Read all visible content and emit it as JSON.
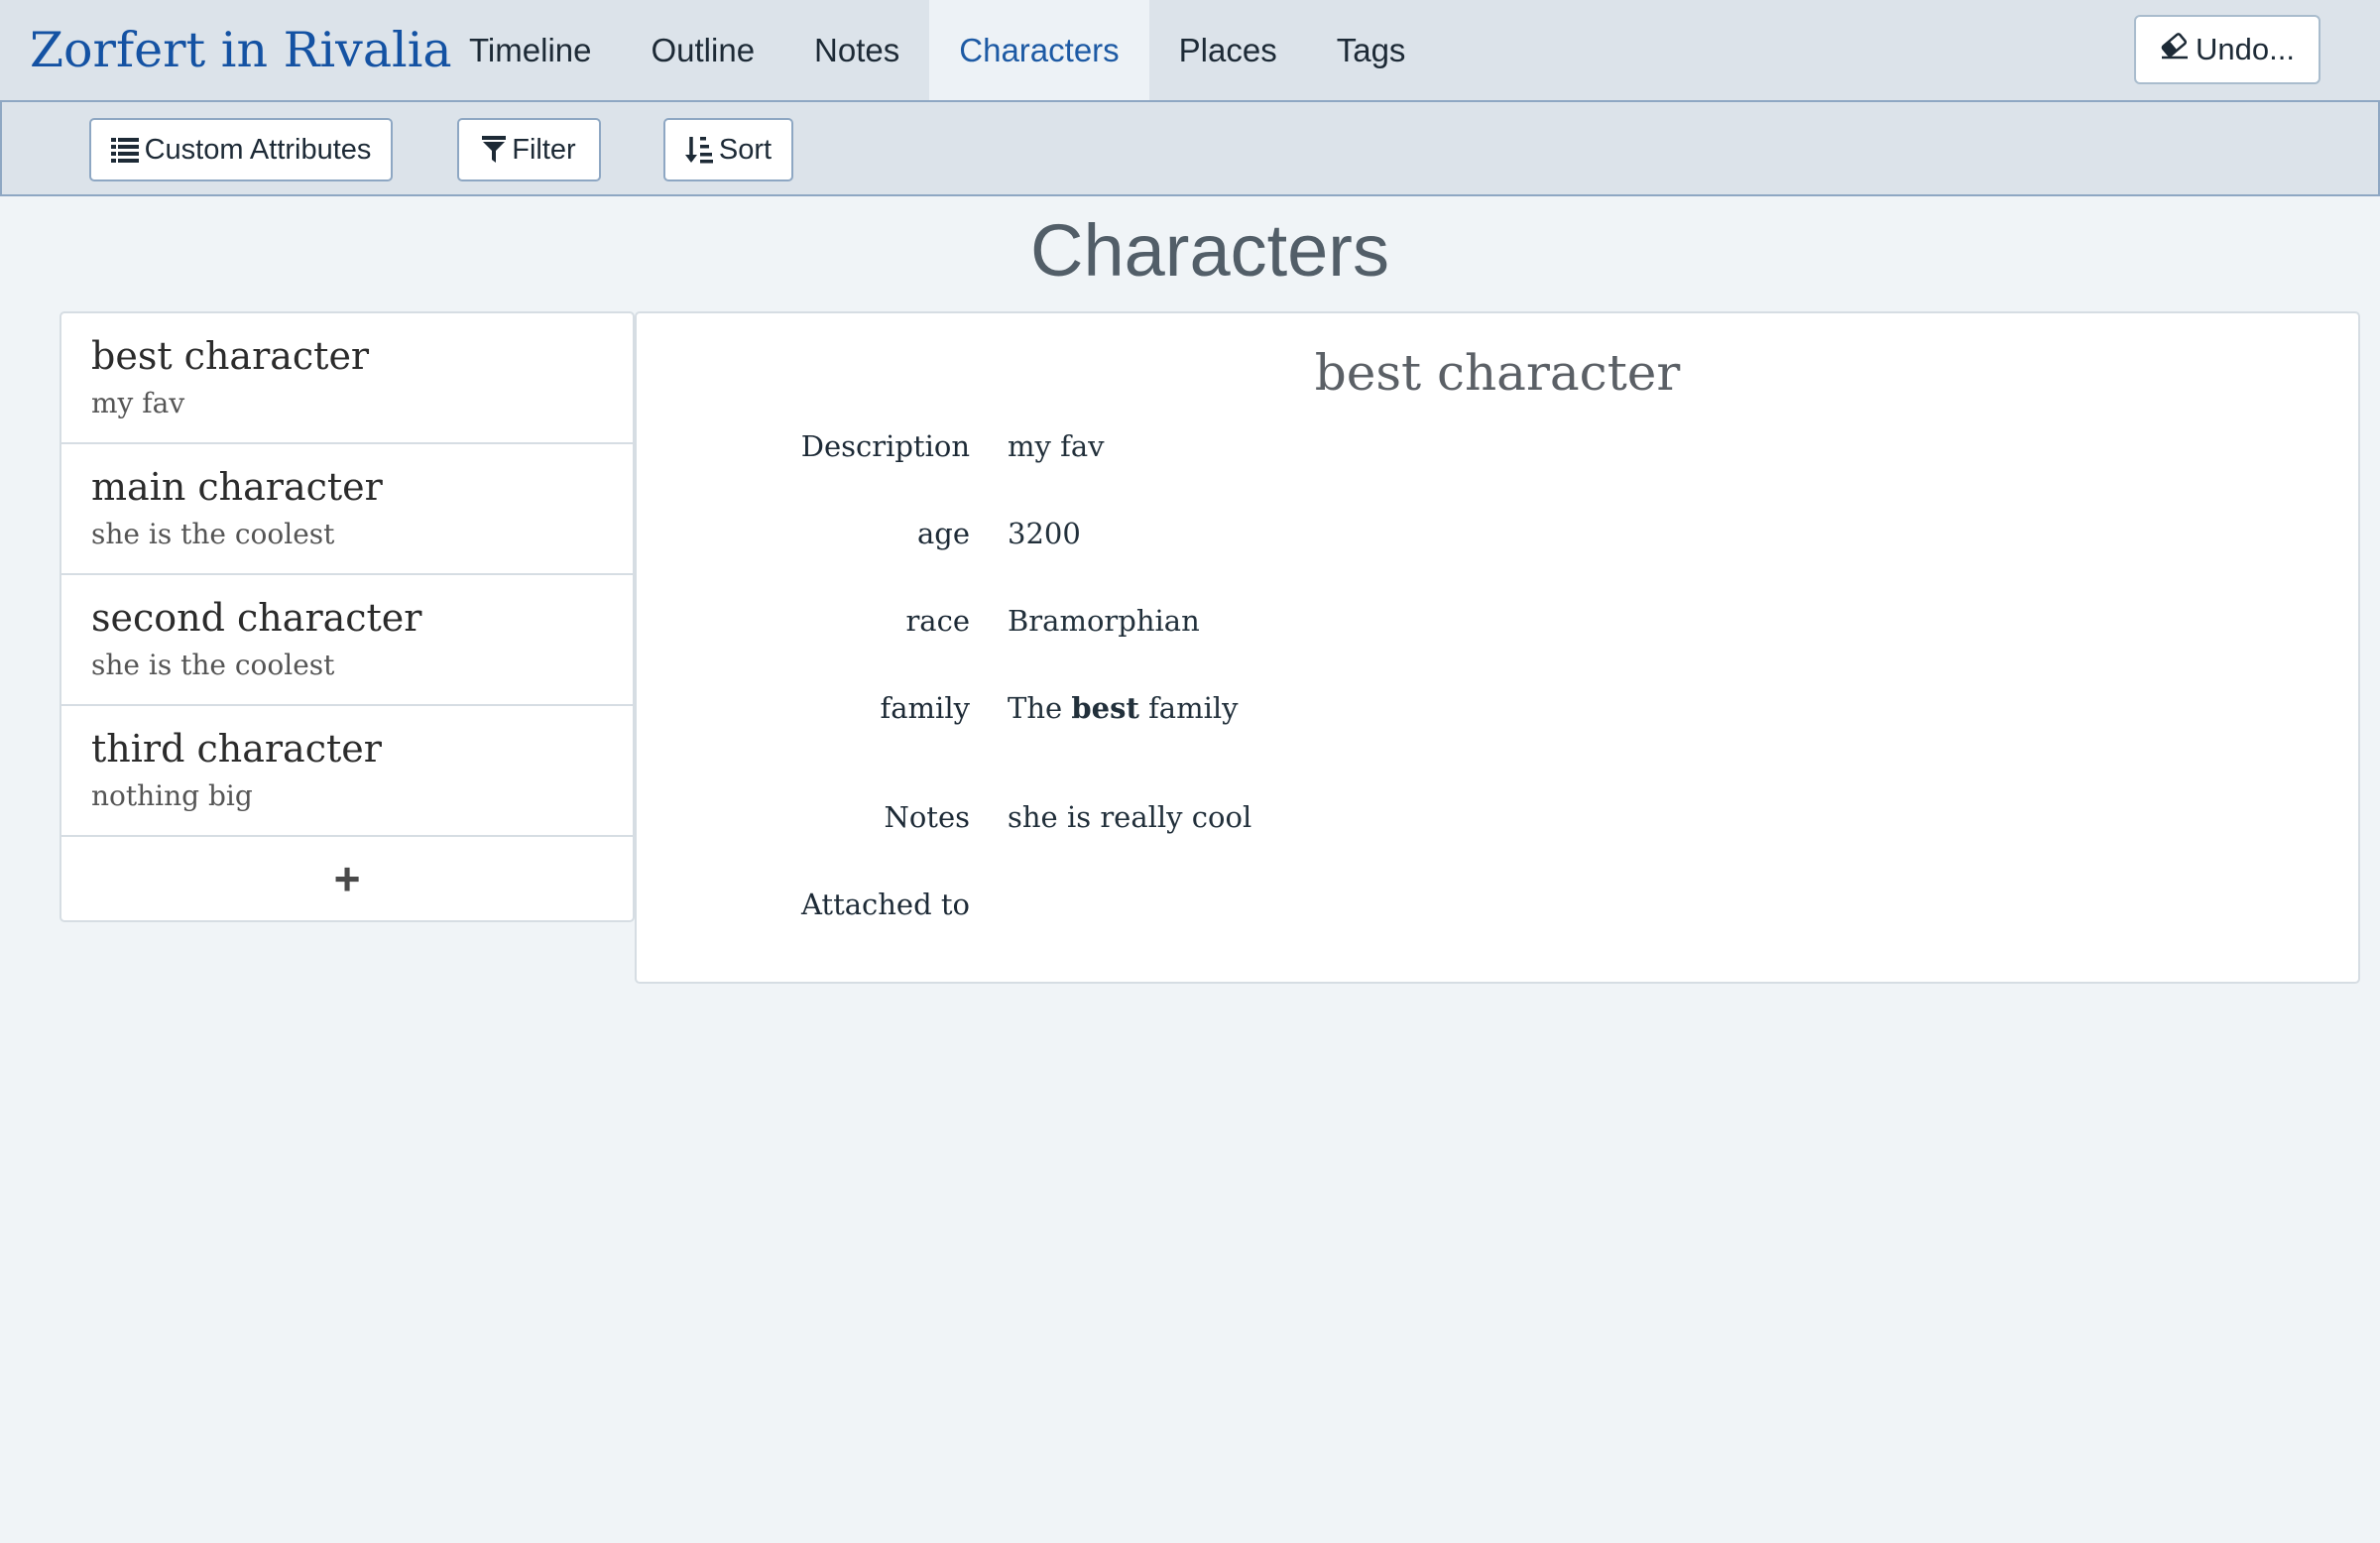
{
  "app": {
    "title": "Zorfert in Rivalia"
  },
  "nav": {
    "tabs": [
      {
        "label": "Timeline"
      },
      {
        "label": "Outline"
      },
      {
        "label": "Notes"
      },
      {
        "label": "Characters",
        "active": true
      },
      {
        "label": "Places"
      },
      {
        "label": "Tags"
      }
    ],
    "undo_label": "Undo...",
    "undo_icon": "eraser-icon"
  },
  "toolbar": {
    "custom_attributes_label": "Custom Attributes",
    "filter_label": "Filter",
    "sort_label": "Sort"
  },
  "page": {
    "title": "Characters"
  },
  "characters": [
    {
      "name": "best character",
      "description": "my fav"
    },
    {
      "name": "main character",
      "description": "she is the coolest"
    },
    {
      "name": "second character",
      "description": "she is the coolest"
    },
    {
      "name": "third character",
      "description": "nothing big"
    }
  ],
  "add_label": "+",
  "detail": {
    "title": "best character",
    "fields": {
      "description": {
        "label": "Description",
        "value": "my fav"
      },
      "age": {
        "label": "age",
        "value": "3200"
      },
      "race": {
        "label": "race",
        "value": "Bramorphian"
      },
      "family": {
        "label": "family",
        "value_before": "The",
        "value_bold": "best",
        "value_after": "family"
      },
      "notes": {
        "label": "Notes",
        "value": "she is really cool"
      },
      "attached_to": {
        "label": "Attached to",
        "value": ""
      }
    }
  },
  "colors": {
    "brand": "#1452a3",
    "nav_bg": "#dce3ea",
    "page_bg": "#f0f4f7",
    "active_tab_bg": "#edf2f6",
    "active_tab_text": "#1d5aa4"
  }
}
